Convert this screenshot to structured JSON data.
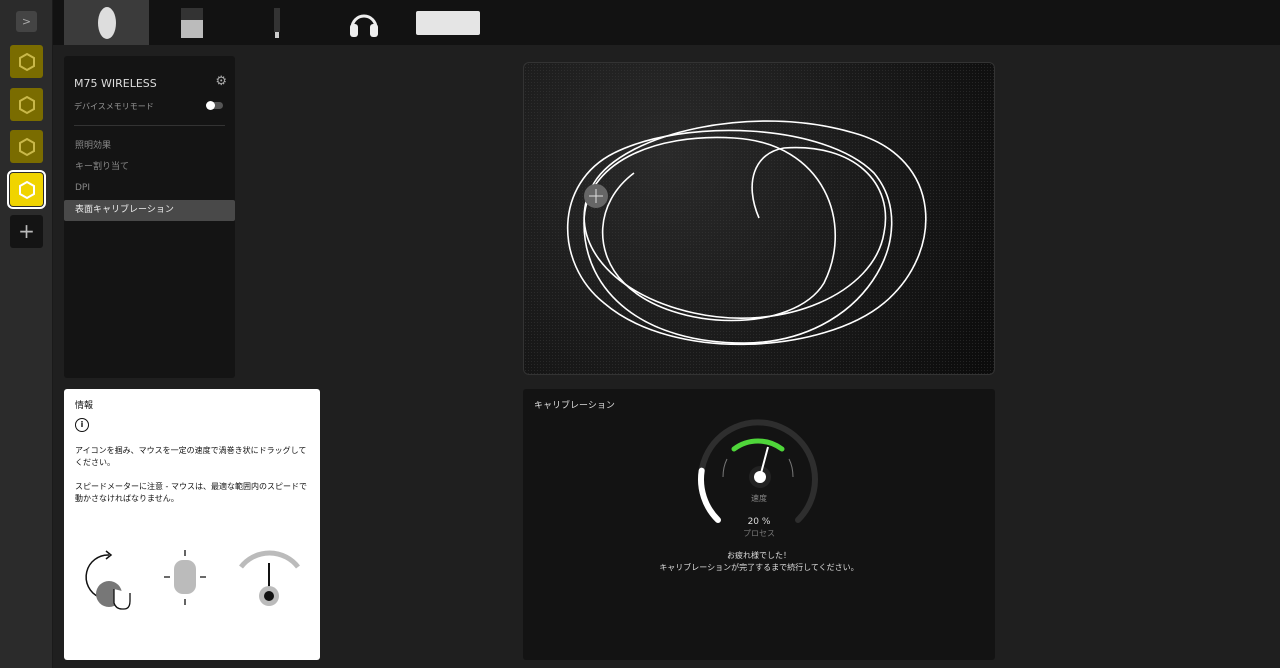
{
  "rail": {
    "expand_icon": "chevron-right-icon",
    "add_label": "+"
  },
  "devices": [
    "mouse",
    "usb-receiver",
    "usb-dongle",
    "headset",
    "keyboard"
  ],
  "sidebar": {
    "title": "M75 WIRELESS",
    "memory_mode": "デバイスメモリモード",
    "memory_mode_on": false,
    "items": [
      {
        "label": "照明効果"
      },
      {
        "label": "キー割り当て"
      },
      {
        "label": "DPI"
      },
      {
        "label": "表面キャリブレーション"
      }
    ]
  },
  "info": {
    "title": "情報",
    "text1": "アイコンを掴み、マウスを一定の速度で渦巻き状にドラッグしてください。",
    "text2": "スピードメーターに注意 - マウスは、最適な範囲内のスピードで動かさなければなりません。"
  },
  "calibration": {
    "title": "キャリブレーション",
    "speed_label": "速度",
    "progress": "20 %",
    "progress_value": 20,
    "progress_label": "プロセス",
    "msg1": "お疲れ様でした！",
    "msg2": "キャリブレーションが完了するまで続行してください。",
    "accent": "#4fd63a"
  }
}
